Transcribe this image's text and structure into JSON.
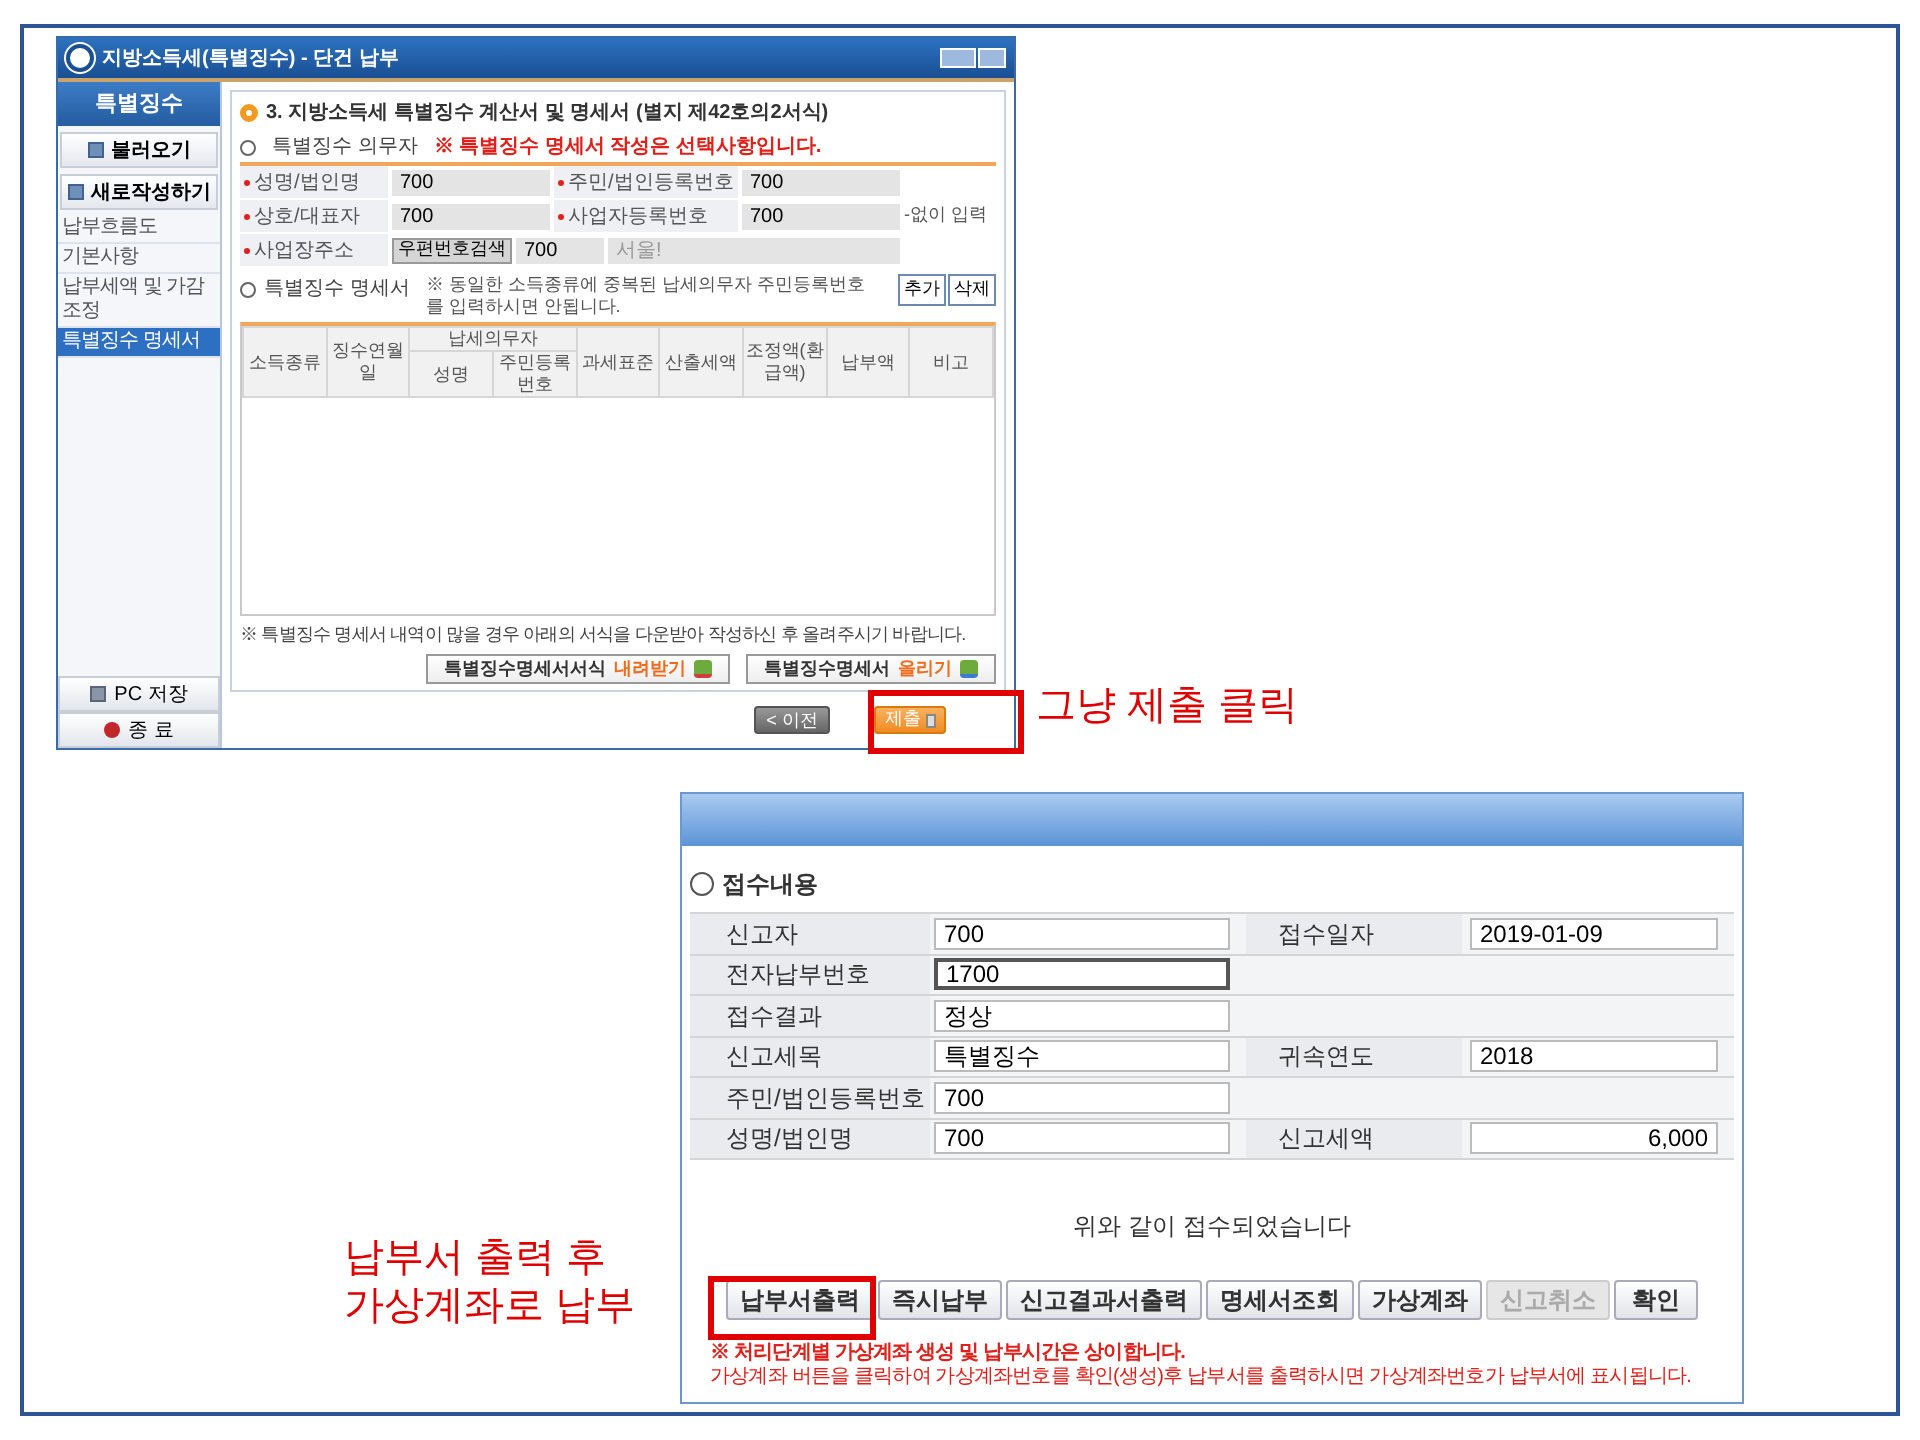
{
  "window": {
    "title": "지방소득세(특별징수) - 단건 납부",
    "sidebar": {
      "title": "특별징수",
      "actions": [
        {
          "label": "불러오기"
        },
        {
          "label": "새로작성하기"
        }
      ],
      "items": [
        {
          "label": "납부흐름도",
          "selected": false
        },
        {
          "label": "기본사항",
          "selected": false
        },
        {
          "label": "납부세액 및 가감조정",
          "selected": false
        },
        {
          "label": "특별징수 명세서",
          "selected": true
        }
      ],
      "bottom": [
        {
          "label": "PC 저장"
        },
        {
          "label": "종 료"
        }
      ]
    },
    "heading": "3. 지방소득세 특별징수 계산서 및 명세서 (별지 제42호의2서식)",
    "payer": {
      "title": "특별징수 의무자",
      "warning": "※ 특별징수 명세서 작성은 선택사항입니다.",
      "fields": [
        {
          "label": "성명/법인명",
          "value": "700"
        },
        {
          "label": "주민/법인등록번호",
          "value": "700"
        },
        {
          "label": "상호/대표자",
          "value": "700"
        },
        {
          "label": "사업자등록번호",
          "value": "700",
          "hint": "-없이 입력"
        }
      ],
      "address": {
        "label": "사업장주소",
        "button": "우편번호검색",
        "value": "700",
        "detail": "서울!"
      }
    },
    "statement": {
      "title": "특별징수 명세서",
      "notice": "※ 동일한 소득종류에 중복된 납세의무자 주민등록번호를 입력하시면 안됩니다.",
      "buttons": [
        "추가",
        "삭제"
      ],
      "columns": [
        {
          "label": "소득종류"
        },
        {
          "label": "징수연월일"
        },
        {
          "label": "납세의무자",
          "children": [
            {
              "label": "성명"
            },
            {
              "label": "주민등록번호"
            }
          ]
        },
        {
          "label": "과세표준"
        },
        {
          "label": "산출세액"
        },
        {
          "label": "조정액(환급액)"
        },
        {
          "label": "납부액"
        },
        {
          "label": "비고"
        }
      ],
      "note": "※ 특별징수 명세서 내역이 많을 경우 아래의 서식을 다운받아 작성하신 후 올려주시기 바랍니다.",
      "files": [
        {
          "label": "특별징수명세서서식",
          "action": "내려받기"
        },
        {
          "label": "특별징수명세서",
          "action": "올리기"
        }
      ]
    },
    "nav": {
      "prev": "< 이전",
      "submit": "제출"
    }
  },
  "dialog": {
    "title": "접수내용",
    "rows": [
      [
        {
          "label": "신고자",
          "value": "700",
          "kind": "text",
          "focused": false
        },
        {
          "label": "접수일자",
          "value": "2019-01-09",
          "kind": "text",
          "focused": false
        }
      ],
      [
        {
          "label": "전자납부번호",
          "value": "1700",
          "kind": "text",
          "focused": true
        }
      ],
      [
        {
          "label": "접수결과",
          "value": "정상",
          "kind": "text",
          "focused": false
        }
      ],
      [
        {
          "label": "신고세목",
          "value": "특별징수",
          "kind": "text",
          "focused": false
        },
        {
          "label": "귀속연도",
          "value": "2018",
          "kind": "text",
          "focused": false
        }
      ],
      [
        {
          "label": "주민/법인등록번호",
          "value": "700",
          "kind": "text",
          "focused": false
        }
      ],
      [
        {
          "label": "성명/법인명",
          "value": "700",
          "kind": "text",
          "focused": false
        },
        {
          "label": "신고세액",
          "value": "6,000",
          "kind": "amount",
          "focused": false
        }
      ]
    ],
    "message": "위와 같이 접수되었습니다",
    "buttons": [
      {
        "label": "납부서출력",
        "disabled": false
      },
      {
        "label": "즉시납부",
        "disabled": false
      },
      {
        "label": "신고결과서출력",
        "disabled": false
      },
      {
        "label": "명세서조회",
        "disabled": false
      },
      {
        "label": "가상계좌",
        "disabled": false
      },
      {
        "label": "신고취소",
        "disabled": true
      },
      {
        "label": "확인",
        "disabled": false
      }
    ],
    "notes": [
      "※ 처리단계별 가상계좌 생성 및 납부시간은 상이합니다.",
      "가상계좌 버튼을 클릭하여 가상계좌번호를 확인(생성)후 납부서를 출력하시면 가상계좌번호가 납부서에 표시됩니다."
    ]
  },
  "annotations": [
    {
      "lines": [
        "그냥 제출 클릭"
      ]
    },
    {
      "lines": [
        "납부서 출력 후",
        "가상계좌로 납부"
      ]
    }
  ]
}
